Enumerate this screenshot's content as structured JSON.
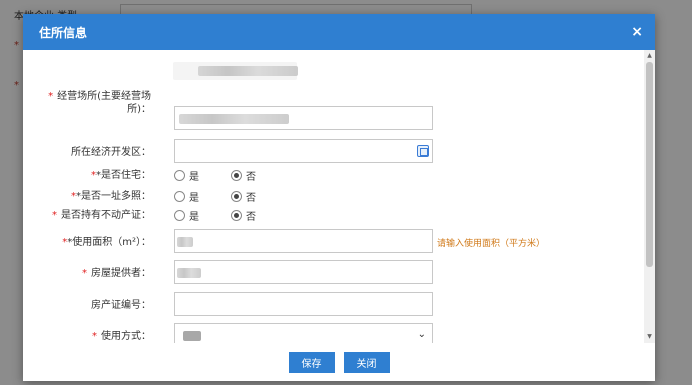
{
  "background": {
    "partial_label": "本地企业 类型"
  },
  "modal": {
    "title": "住所信息",
    "close_glyph": "×"
  },
  "form": {
    "business_premises_label_1": "经营场所(主要经营场",
    "business_premises_label_2": "所)：",
    "econ_zone_label": "所在经济开发区：",
    "is_residence_label": "*是否住宅：",
    "one_addr_label": "*是否一址多照：",
    "property_cert_label": "是否持有不动产证：",
    "area_label": "*使用面积（m²）：",
    "area_hint": "请输入使用面积（平方米）",
    "provider_label": "房屋提供者：",
    "cert_no_label": "房产证编号：",
    "usage_label": "使用方式：",
    "yes": "是",
    "no": "否"
  },
  "buttons": {
    "save": "保存",
    "close": "关闭"
  },
  "colors": {
    "header": "#2f7fd1",
    "required": "#e02020",
    "hint": "#d07a1a"
  }
}
